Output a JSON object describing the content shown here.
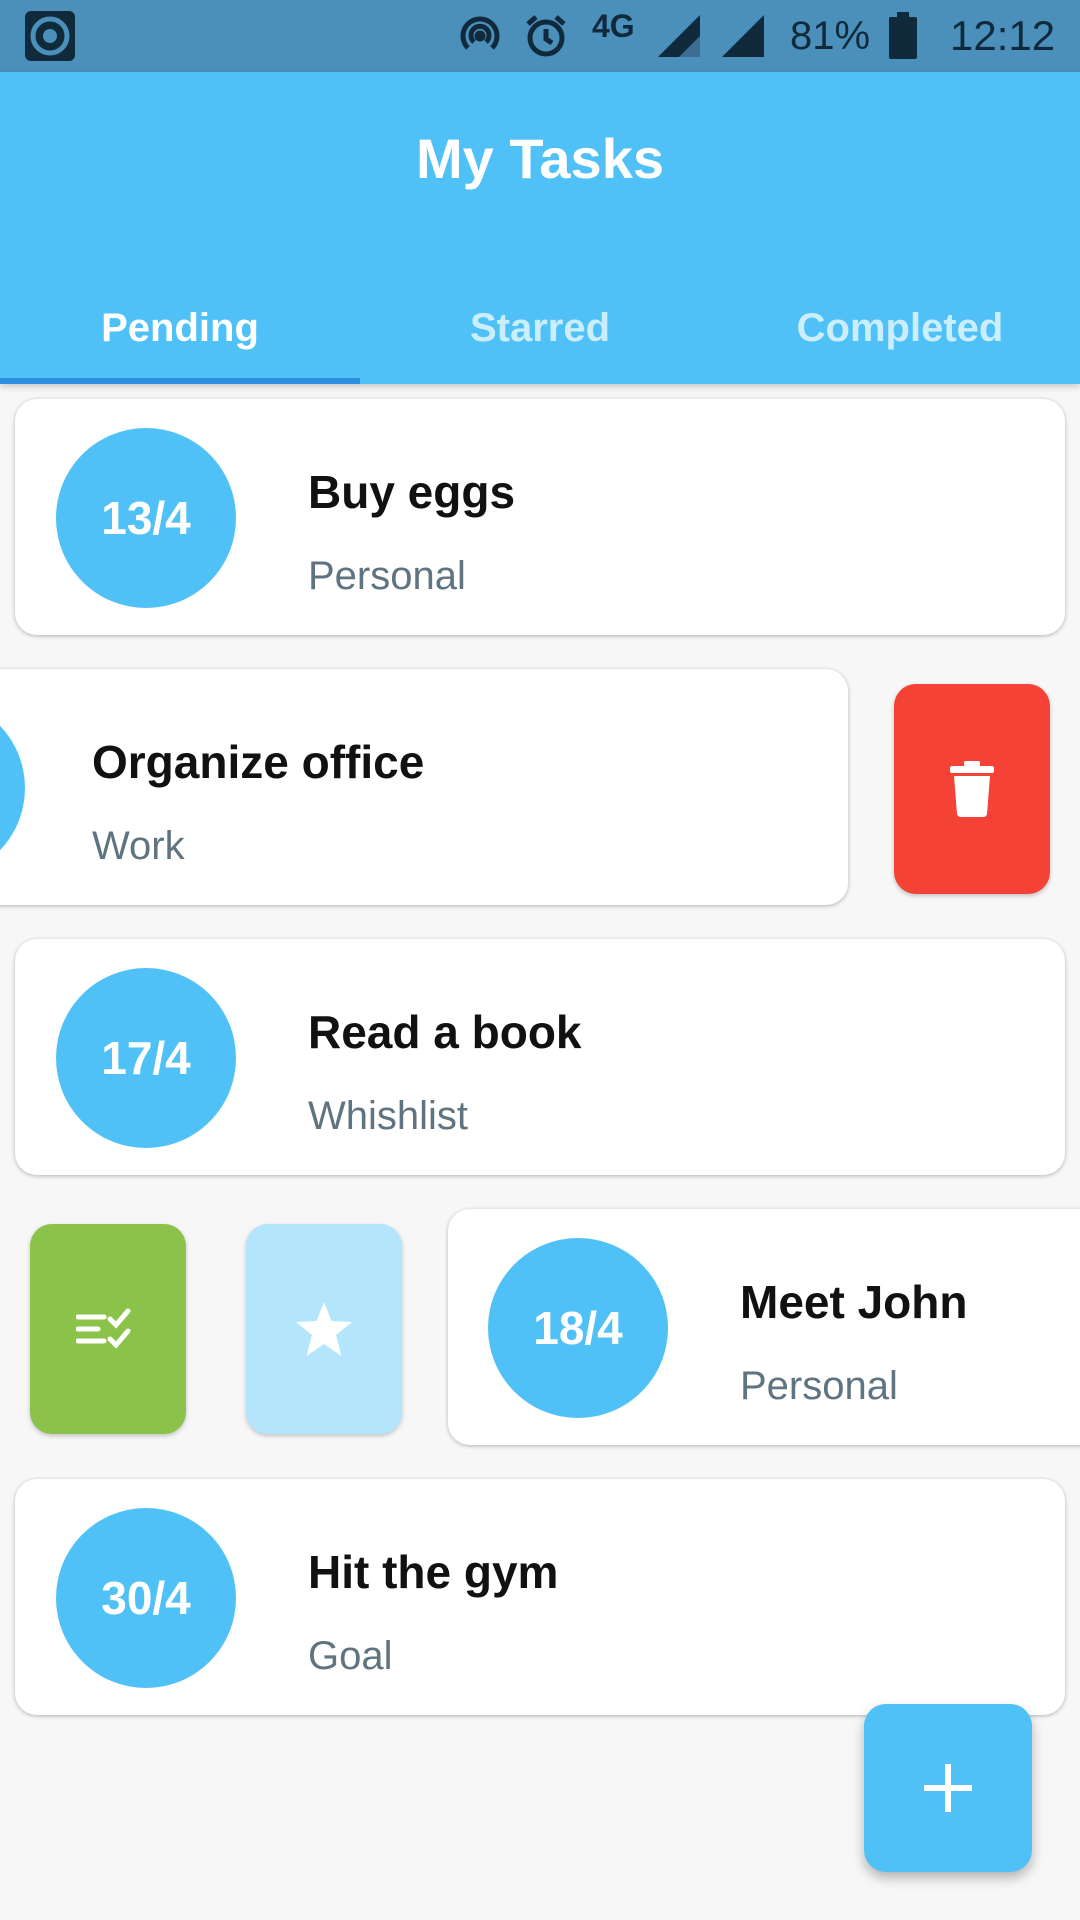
{
  "status_bar": {
    "network": "4G",
    "battery": "81%",
    "time": "12:12"
  },
  "app_bar": {
    "title": "My Tasks",
    "tabs": [
      {
        "label": "Pending",
        "selected": true
      },
      {
        "label": "Starred",
        "selected": false
      },
      {
        "label": "Completed",
        "selected": false
      }
    ]
  },
  "tasks": [
    {
      "date": "13/4",
      "title": "Buy eggs",
      "category": "Personal"
    },
    {
      "date": "",
      "title": "Organize office",
      "category": "Work",
      "swiped": "left",
      "revealed_action": "delete-icon"
    },
    {
      "date": "17/4",
      "title": "Read a book",
      "category": "Whishlist"
    },
    {
      "date": "18/4",
      "title": "Meet John",
      "category": "Personal",
      "swiped": "right",
      "revealed_actions": [
        "complete-icon",
        "star-icon"
      ]
    },
    {
      "date": "30/4",
      "title": "Hit the gym",
      "category": "Goal"
    }
  ],
  "actions": {
    "delete_color": "#f44336",
    "complete_color": "#8bc34a",
    "star_color": "#b3e5fc"
  },
  "fab": {
    "icon": "plus-icon"
  },
  "colors": {
    "primary": "#50c1f6",
    "tab_indicator": "#2b8fe0",
    "status_bar": "#4a90bb"
  }
}
